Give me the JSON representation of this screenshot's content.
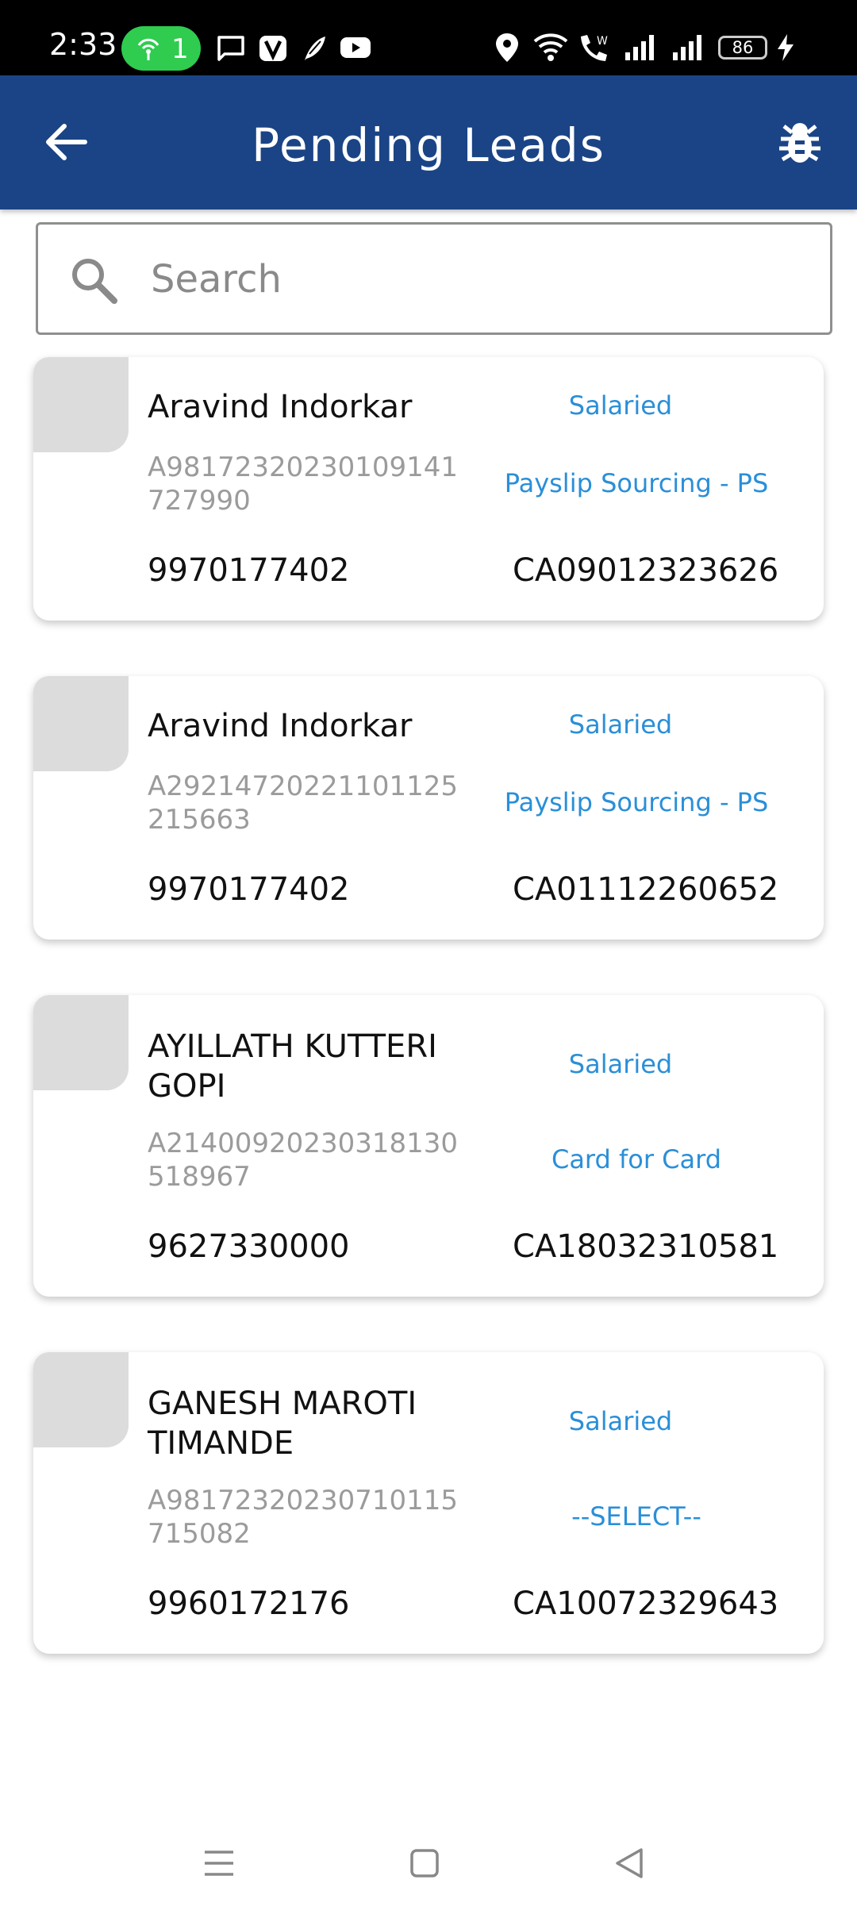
{
  "status_bar": {
    "time": "2:33",
    "hotspot_count": "1",
    "battery": "86",
    "icons": [
      "hotspot-icon",
      "message-icon",
      "v-app-icon",
      "feather-icon",
      "youtube-icon",
      "location-icon",
      "wifi-icon",
      "wifi-call-icon",
      "signal-icon",
      "signal-icon",
      "battery-icon",
      "charging-icon"
    ]
  },
  "app_bar": {
    "title": "Pending Leads"
  },
  "search": {
    "placeholder": "Search",
    "value": ""
  },
  "leads": [
    {
      "name": "Aravind  Indorkar",
      "app_id": "A98172320230109141727990",
      "phone": "9970177402",
      "employment_type": "Salaried",
      "source": "Payslip Sourcing - PS",
      "ca_number": "CA09012323626"
    },
    {
      "name": "Aravind  Indorkar",
      "app_id": "A29214720221101125215663",
      "phone": "9970177402",
      "employment_type": "Salaried",
      "source": "Payslip Sourcing - PS",
      "ca_number": "CA01112260652"
    },
    {
      "name": "AYILLATH KUTTERI GOPI",
      "app_id": "A21400920230318130518967",
      "phone": "9627330000",
      "employment_type": "Salaried",
      "source": "Card for Card",
      "ca_number": "CA18032310581"
    },
    {
      "name": "GANESH MAROTI TIMANDE",
      "app_id": "A98172320230710115715082",
      "phone": "9960172176",
      "employment_type": "Salaried",
      "source": "--SELECT--",
      "ca_number": "CA10072329643"
    }
  ],
  "colors": {
    "app_bar": "#1a4486",
    "accent_text": "#2a8fd8",
    "secondary_text": "#9b9b9b"
  }
}
